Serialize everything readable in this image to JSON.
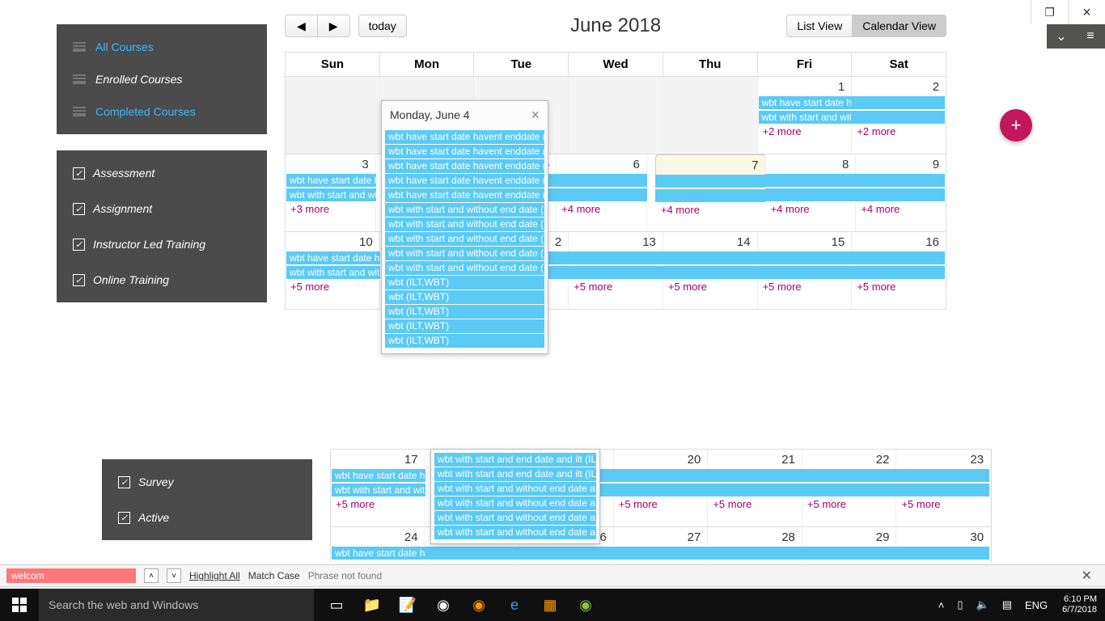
{
  "nav": {
    "all": "All Courses",
    "enrolled": "Enrolled Courses",
    "completed": "Completed Courses"
  },
  "filters": {
    "assessment": "Assessment",
    "assignment": "Assignment",
    "ilt": "Instructor Led Training",
    "online": "Online Training",
    "survey": "Survey",
    "active": "Active"
  },
  "cal": {
    "title": "June 2018",
    "today": "today",
    "list": "List View",
    "calendar": "Calendar View",
    "days": [
      "Sun",
      "Mon",
      "Tue",
      "Wed",
      "Thu",
      "Fri",
      "Sat"
    ]
  },
  "weeks": [
    {
      "nums": [
        "",
        "",
        "",
        "",
        "",
        "1",
        "2"
      ],
      "fri_evt1": "wbt have start date havent enddate (WBT)",
      "fri_evt2": "wbt with start and without end date (WBT)",
      "more_fri": "+2 more",
      "more_sat": "+2 more"
    },
    {
      "nums": [
        "3",
        "",
        "5",
        "6",
        "7",
        "8",
        "9"
      ],
      "e1": "wbt have start date h",
      "e2": "wbt with start and wit",
      "more_sun": "+3 more",
      "more_wed": "+4 more",
      "more_thu": "+4 more",
      "more_fri": "+4 more",
      "more_sat": "+4 more"
    },
    {
      "nums": [
        "10",
        "",
        "2",
        "13",
        "14",
        "15",
        "16"
      ],
      "e1": "wbt have start date h",
      "e2": "wbt with start and wit",
      "more_sun": "+5 more",
      "more_wed": "+5 more",
      "more_thu": "+5 more",
      "more_fri": "+5 more",
      "more_sat": "+5 more"
    }
  ],
  "pop": {
    "title": "Monday, June 4",
    "items": [
      "wbt have start date havent enddate (",
      "wbt have start date havent enddate (",
      "wbt have start date havent enddate (",
      "wbt have start date havent enddate (",
      "wbt have start date havent enddate (",
      "wbt with start and without end date (",
      "wbt with start and without end date (",
      "wbt with start and without end date (",
      "wbt with start and without end date (",
      "wbt with start and without end date (",
      "wbt (ILT,WBT)",
      "wbt (ILT,WBT)",
      "wbt (ILT,WBT)",
      "wbt (ILT,WBT)",
      "wbt (ILT,WBT)"
    ]
  },
  "lower": {
    "row1": {
      "nums": [
        "17",
        "",
        "",
        "20",
        "21",
        "22",
        "23"
      ],
      "e1": "wbt have start date h",
      "e2": "wbt with start and wit",
      "m1": "+5 more",
      "m4": "+5 more",
      "m5": "+5 more",
      "m6": "+5 more",
      "m7": "+5 more"
    },
    "row2": {
      "nums": [
        "24",
        "",
        "6",
        "27",
        "28",
        "29",
        "30"
      ],
      "e1": "wbt have start date havent enddate (WBT)"
    },
    "pop_items": [
      "wbt with start and end date and ilt (IL",
      "wbt with start and end date and ilt (IL",
      "wbt with start and without end date a",
      "wbt with start and without end date a",
      "wbt with start and without end date a",
      "wbt with start and without end date a"
    ]
  },
  "find": {
    "query": "welcom",
    "hl": "Highlight All",
    "mc": "Match Case",
    "nf": "Phrase not found"
  },
  "tray": {
    "lang": "ENG",
    "time": "6:10 PM",
    "date": "6/7/2018",
    "search": "Search the web and Windows"
  }
}
